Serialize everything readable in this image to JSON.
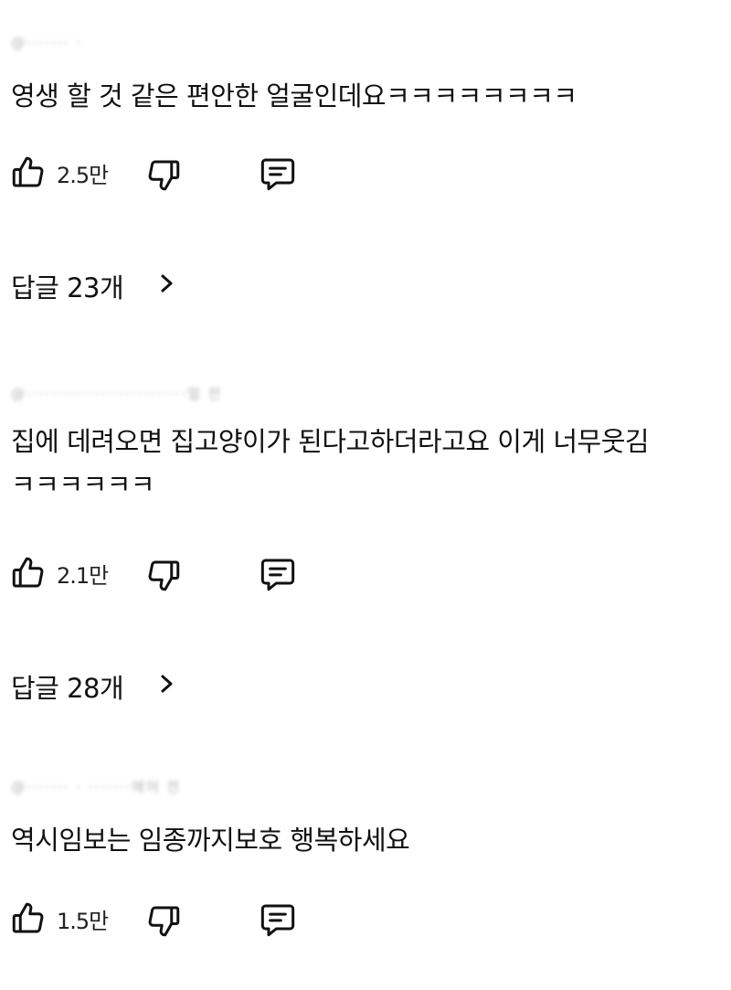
{
  "comments": [
    {
      "author_line": "@·······  ·",
      "text": "영생 할 것 같은 편안한 얼굴인데요ㅋㅋㅋㅋㅋㅋㅋㅋ",
      "likes": "2.5만",
      "replies_label": "답글 23개"
    },
    {
      "author_line": "@··························얼 전",
      "text": "집에 데려오면 집고양이가 된다고하더라고요 이게 너무웃김\nㅋㅋㅋㅋㅋㅋ",
      "likes": "2.1만",
      "replies_label": "답글 28개"
    },
    {
      "author_line": "@·······  ·      ·······에어 전",
      "text": "역시임보는 임종까지보호 행복하세요",
      "likes": "1.5만"
    }
  ],
  "icons": {
    "like": "thumbs-up-outline",
    "dislike": "thumbs-down-outline",
    "reply": "chat-bubble-outline",
    "chevron": "chevron-right"
  },
  "colors": {
    "text": "#111111",
    "muted": "#9a9a9a",
    "background": "#ffffff"
  }
}
